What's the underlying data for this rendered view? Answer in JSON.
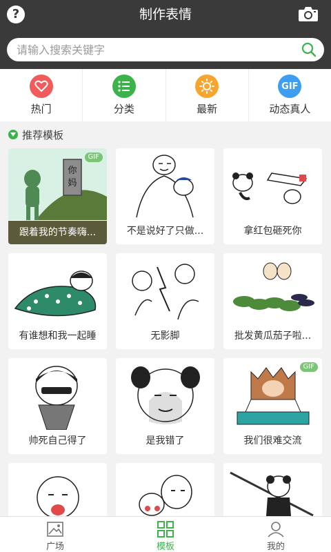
{
  "header": {
    "title": "制作表情",
    "help_label": "?"
  },
  "search": {
    "placeholder": "请输入搜索关键字",
    "value": ""
  },
  "categories": [
    {
      "label": "热门",
      "icon": "heart-icon",
      "color": "#f25b5b"
    },
    {
      "label": "分类",
      "icon": "list-icon",
      "color": "#3cb34a"
    },
    {
      "label": "最新",
      "icon": "sun-icon",
      "color": "#f7a52e"
    },
    {
      "label": "动态真人",
      "icon": "gif-icon",
      "icon_text": "GIF",
      "color": "#3d9ef1"
    }
  ],
  "section": {
    "title": "推荐模板"
  },
  "templates": [
    {
      "caption": "跟着我的节奏嗨...",
      "badge": "GIF",
      "sign_text": "你妈"
    },
    {
      "caption": "不是说好了只做..."
    },
    {
      "caption": "拿红包砸死你"
    },
    {
      "caption": "有谁想和我一起睡"
    },
    {
      "caption": "无影脚"
    },
    {
      "caption": "批发黄瓜茄子啦..."
    },
    {
      "caption": "帅死自己得了"
    },
    {
      "caption": "是我错了"
    },
    {
      "caption": "我们很难交流",
      "badge": "GIF"
    },
    {
      "caption": ""
    },
    {
      "caption": ""
    },
    {
      "caption": ""
    }
  ],
  "tabs": [
    {
      "label": "广场",
      "icon": "image-icon"
    },
    {
      "label": "模板",
      "icon": "grid-icon",
      "active": true
    },
    {
      "label": "我的",
      "icon": "user-icon"
    }
  ],
  "colors": {
    "topbar": "#3a3a3a",
    "accent": "#3cb34a",
    "background": "#f2f2f2"
  }
}
